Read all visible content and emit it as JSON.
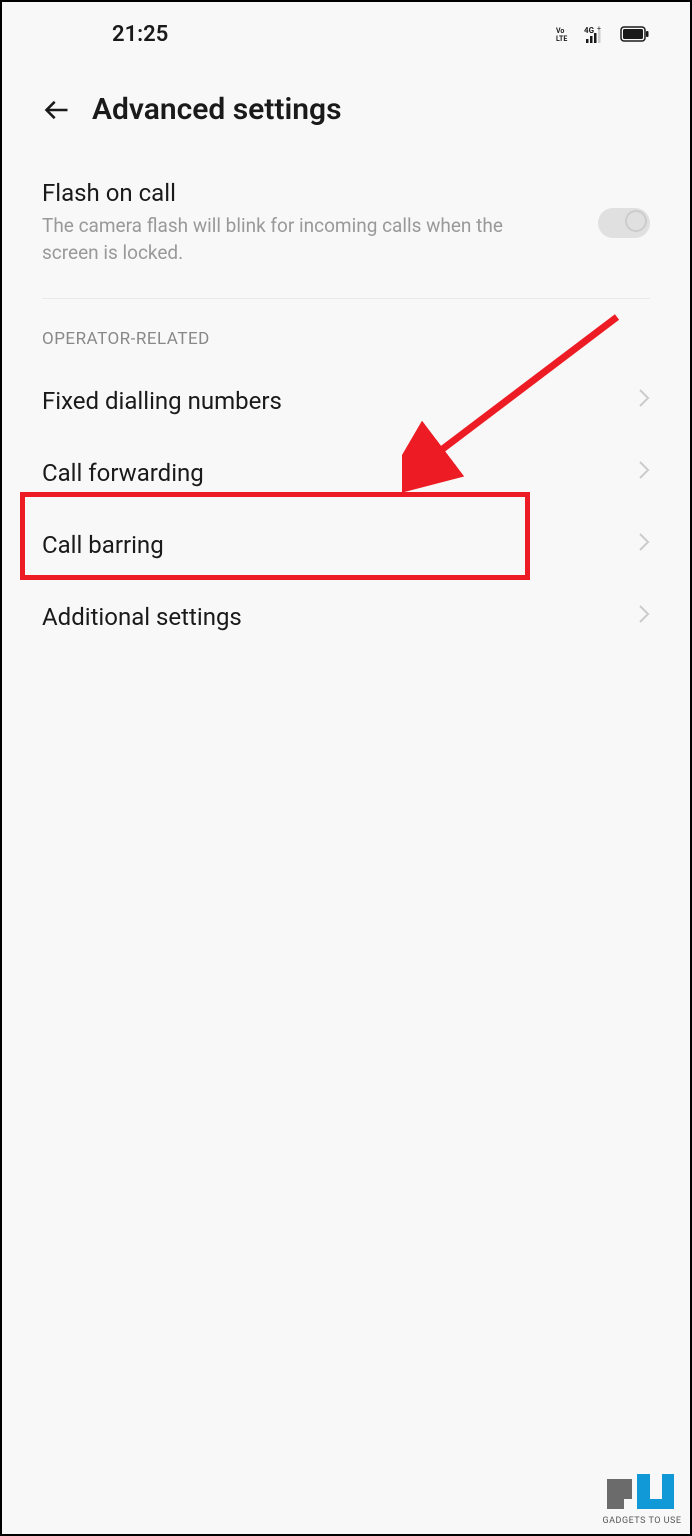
{
  "statusBar": {
    "time": "21:25",
    "volte": "Vo LTE",
    "signal": "4G+"
  },
  "header": {
    "title": "Advanced settings"
  },
  "flashOnCall": {
    "title": "Flash on call",
    "desc": "The camera flash will blink for incoming calls when the screen is locked.",
    "enabled": false
  },
  "sectionHeader": "OPERATOR-RELATED",
  "items": [
    {
      "label": "Fixed dialling numbers"
    },
    {
      "label": "Call forwarding"
    },
    {
      "label": "Call barring"
    },
    {
      "label": "Additional settings"
    }
  ],
  "watermark": "GADGETS TO USE"
}
